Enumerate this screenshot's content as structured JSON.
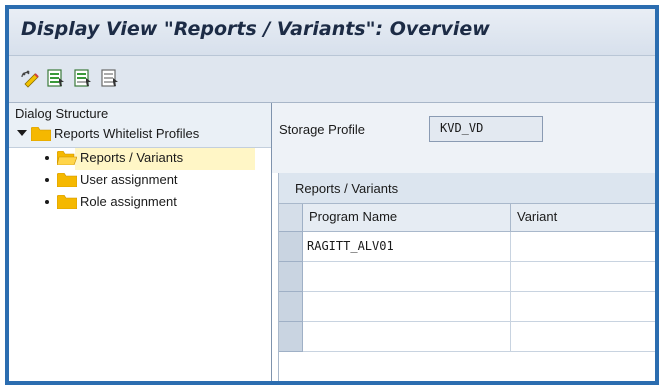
{
  "window": {
    "title": "Display View \"Reports / Variants\": Overview"
  },
  "toolbar": {
    "buttons": [
      {
        "name": "other-view-icon"
      },
      {
        "name": "select-all-icon"
      },
      {
        "name": "select-block-icon"
      },
      {
        "name": "deselect-all-icon"
      }
    ]
  },
  "dialog_structure": {
    "title": "Dialog Structure",
    "root": {
      "label": "Reports Whitelist Profiles",
      "expanded": true
    },
    "items": [
      {
        "label": "Reports / Variants",
        "selected": true
      },
      {
        "label": "User assignment",
        "selected": false
      },
      {
        "label": "Role assignment",
        "selected": false
      }
    ]
  },
  "storage_profile": {
    "label": "Storage Profile",
    "value": "KVD_VD"
  },
  "table": {
    "title": "Reports / Variants",
    "columns": [
      "Program Name",
      "Variant"
    ],
    "rows": [
      [
        "RAGITT_ALV01",
        ""
      ],
      [
        "",
        ""
      ],
      [
        "",
        ""
      ],
      [
        "",
        ""
      ]
    ]
  },
  "colors": {
    "frame_border": "#2b6db0",
    "selected_bg": "#fff6c6",
    "folder": "#f5b800"
  }
}
